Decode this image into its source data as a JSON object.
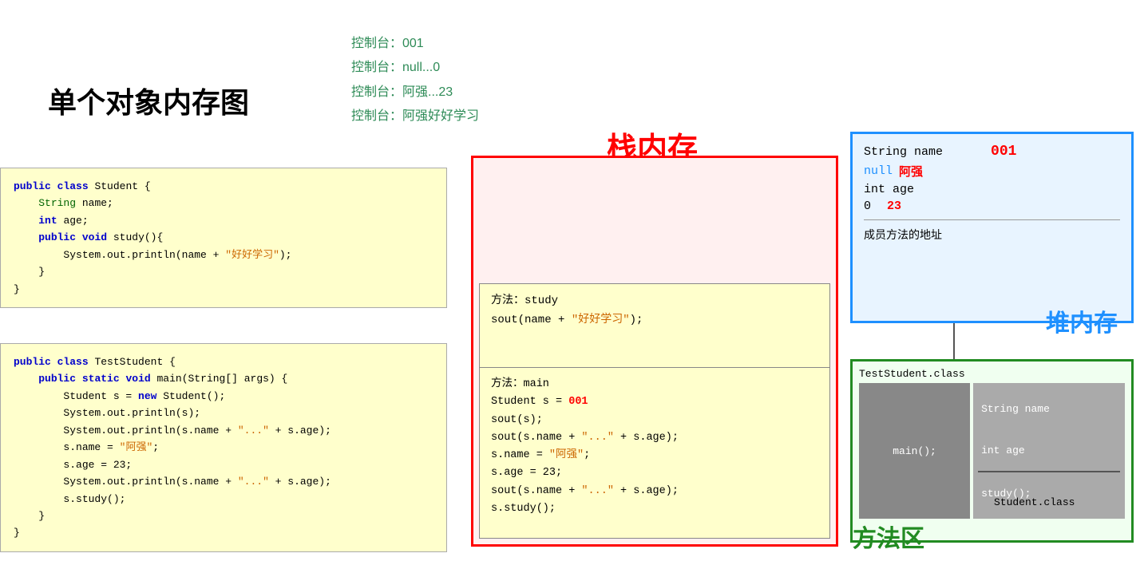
{
  "title": "单个对象内存图",
  "console": {
    "lines": [
      "控制台：001",
      "控制台：null...0",
      "控制台：阿强...23",
      "控制台：阿强好好学习"
    ]
  },
  "stack_label": "栈内存",
  "heap_label": "堆内存",
  "method_label": "方法区",
  "heap": {
    "id": "001",
    "string_name_label": "String name",
    "null_text": "null",
    "name_value": "阿强",
    "int_age_label": "int age",
    "age_zero": "0",
    "age_value": "23",
    "method_addr": "成员方法的地址"
  },
  "method_area": {
    "test_student_class": "TestStudent.class",
    "student_class": "Student.class",
    "main_method": "main();",
    "string_name": "String name",
    "int_age": "int age",
    "study_method": "study();"
  },
  "stack": {
    "study_box": {
      "line1": "方法：study",
      "line2": "sout(name + \"好好学习\");"
    },
    "main_box": {
      "line1": "方法：main",
      "line2": "Student s = 001",
      "line3": "sout(s);",
      "line4": "sout(s.name + \"...\" + s.age);",
      "line5": "s.name = \"阿强\";",
      "line6": "s.age = 23;",
      "line7": "sout(s.name + \"...\" + s.age);",
      "line8": "s.study();"
    }
  }
}
